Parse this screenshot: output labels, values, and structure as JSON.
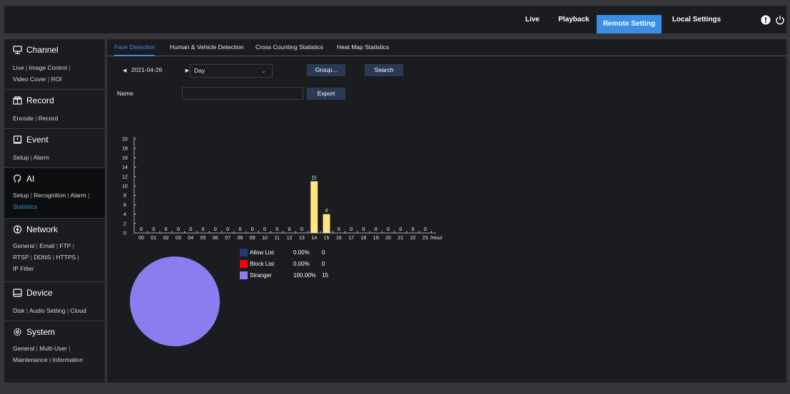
{
  "nav": {
    "live": "Live",
    "playback": "Playback",
    "remote": "Remote Setting",
    "local": "Local Settings"
  },
  "sidebar": {
    "channel": {
      "title": "Channel",
      "links": [
        "Live",
        "Image Control",
        "Video Cover",
        "ROI"
      ]
    },
    "record": {
      "title": "Record",
      "links": [
        "Encode",
        "Record"
      ]
    },
    "event": {
      "title": "Event",
      "links": [
        "Setup",
        "Alarm"
      ]
    },
    "ai": {
      "title": "AI",
      "links": [
        "Setup",
        "Recognition",
        "Alarm",
        "Statistics"
      ]
    },
    "network": {
      "title": "Network",
      "links": [
        "General",
        "Email",
        "FTP",
        "RTSP",
        "DDNS",
        "HTTPS",
        "IP Filter"
      ]
    },
    "device": {
      "title": "Device",
      "links": [
        "Disk",
        "Audio Setting",
        "Cloud"
      ]
    },
    "system": {
      "title": "System",
      "links": [
        "General",
        "Multi-User",
        "Maintenance",
        "Information"
      ]
    }
  },
  "tabs": [
    "Face Detection",
    "Human & Vehicle Detection",
    "Cross Counting Statistics",
    "Heat Map Statistics"
  ],
  "toolbar": {
    "date": "2021-04-26",
    "period": "Day",
    "group_label": "Group...",
    "search_label": "Search",
    "name_label": "Name",
    "name_value": "",
    "export_label": "Export"
  },
  "chart_data": {
    "type": "bar",
    "categories": [
      "00",
      "01",
      "02",
      "03",
      "04",
      "05",
      "06",
      "07",
      "08",
      "09",
      "10",
      "11",
      "12",
      "13",
      "14",
      "15",
      "16",
      "17",
      "18",
      "19",
      "20",
      "21",
      "22",
      "23"
    ],
    "values": [
      0,
      0,
      0,
      0,
      0,
      0,
      0,
      0,
      0,
      0,
      0,
      0,
      0,
      0,
      11,
      4,
      0,
      0,
      0,
      0,
      0,
      0,
      0,
      0
    ],
    "xunit": "/Hour",
    "yticks": [
      0,
      2,
      4,
      6,
      8,
      10,
      12,
      14,
      16,
      18,
      20
    ],
    "ylim": [
      0,
      20
    ],
    "bar_color": "#ffe680"
  },
  "pie_data": {
    "type": "pie",
    "slices": [
      {
        "label": "Allow List",
        "percent": "0.00%",
        "count": "0",
        "color": "#1f3c78"
      },
      {
        "label": "Block List",
        "percent": "0.00%",
        "count": "0",
        "color": "#ff0000"
      },
      {
        "label": "Stranger",
        "percent": "100.00%",
        "count": "15",
        "color": "#8b7df0"
      }
    ]
  }
}
